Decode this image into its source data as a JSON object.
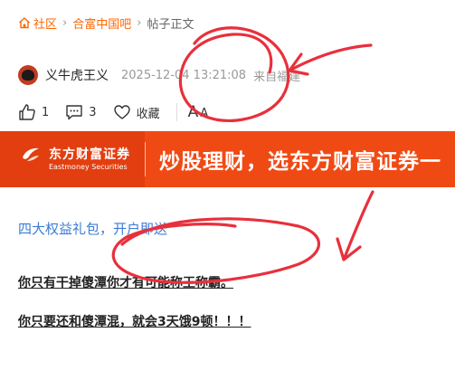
{
  "breadcrumb": {
    "items": [
      "社区",
      "合富中国吧",
      "帖子正文"
    ]
  },
  "author": {
    "name": "义牛虎王义",
    "time": "2025-12-04 13:21:08",
    "location": "来自福建"
  },
  "actions": {
    "likes": "1",
    "comments": "3",
    "favorite_label": "收藏",
    "font_big": "A",
    "font_small": "A"
  },
  "banner": {
    "brand_cn": "东方财富证券",
    "brand_en": "Eastmoney Securities",
    "slogan": "炒股理财，选东方财富证券一"
  },
  "content": {
    "promo_link": "四大权益礼包，开户即送",
    "lines": [
      "你只有干掉傻潭你才有可能称王称霸。",
      "你只要还和傻潭混，就会3天饿9顿！！！"
    ]
  },
  "colors": {
    "accent": "#ff6600",
    "banner": "#f04a14",
    "link": "#3a7bd5",
    "scribble": "#e8303c"
  }
}
